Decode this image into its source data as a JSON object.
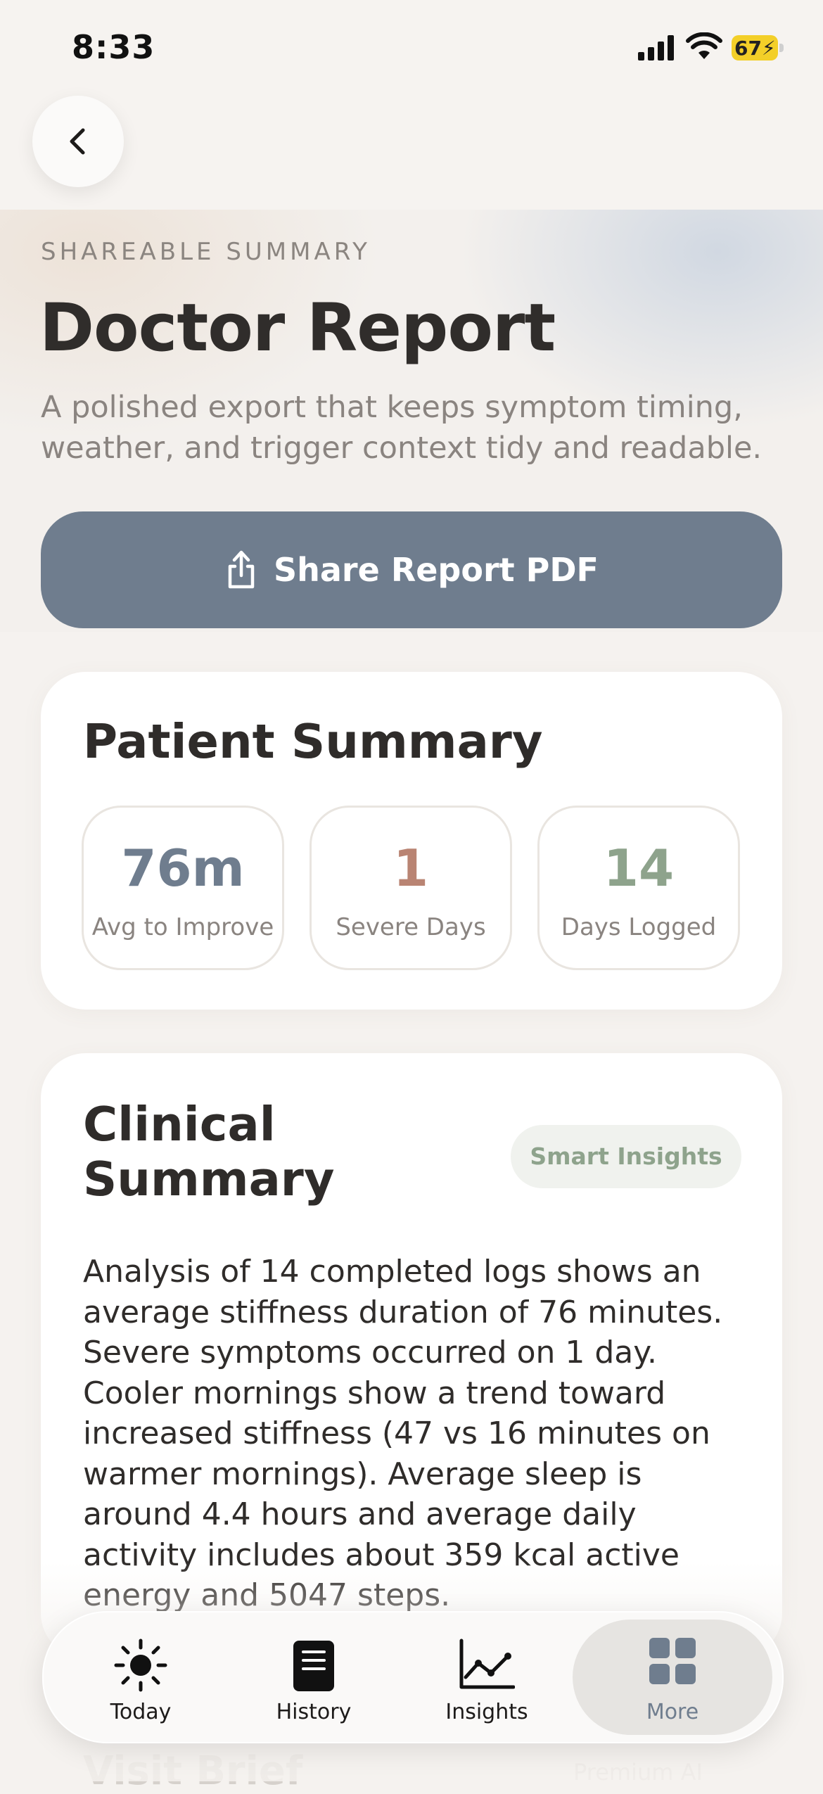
{
  "status_bar": {
    "time": "8:33",
    "battery": "67"
  },
  "header": {
    "eyebrow": "SHAREABLE SUMMARY",
    "title": "Doctor Report",
    "subtitle": "A polished export that keeps symptom timing, weather, and trigger context tidy and readable."
  },
  "share_button": {
    "label": "Share Report PDF",
    "icon": "share-icon"
  },
  "patient_summary": {
    "title": "Patient Summary",
    "stats": [
      {
        "value": "76m",
        "label": "Avg to Improve",
        "color": "#6f7d8e"
      },
      {
        "value": "1",
        "label": "Severe Days",
        "color": "#b98473"
      },
      {
        "value": "14",
        "label": "Days Logged",
        "color": "#8ea38c"
      }
    ]
  },
  "clinical_summary": {
    "title_line1": "Clinical",
    "title_line2": "Summary",
    "chip": "Smart Insights",
    "body": "Analysis of 14 completed logs shows an average stiffness duration of 76 minutes. Severe symptoms occurred on 1 day. Cooler mornings show a trend toward increased stiffness (47 vs 16 minutes on warmer mornings). Average sleep is around 4.4 hours and average daily activity includes about 359 kcal active energy and 5047 steps."
  },
  "next_section": {
    "title": "Visit Brief",
    "chip": "Premium AI"
  },
  "tab_bar": {
    "tabs": [
      {
        "label": "Today",
        "icon": "sun-icon"
      },
      {
        "label": "History",
        "icon": "notebook-icon"
      },
      {
        "label": "Insights",
        "icon": "chart-icon"
      },
      {
        "label": "More",
        "icon": "grid-icon",
        "active": true
      }
    ]
  },
  "colors": {
    "accent": "#6f7d8e",
    "severe": "#b98473",
    "logged": "#8ea38c",
    "background": "#f5f2ef"
  }
}
